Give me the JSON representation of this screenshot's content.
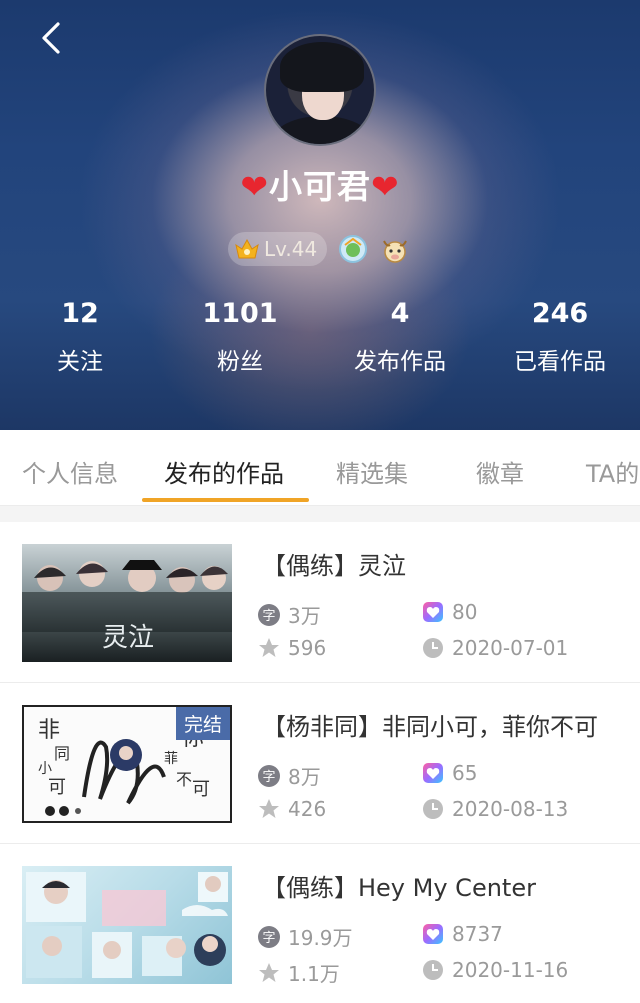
{
  "header": {
    "nickname": "小可君",
    "heart_left": "❤",
    "heart_right": "❤",
    "level": "Lv.44",
    "stats": [
      {
        "num": "12",
        "label": "关注"
      },
      {
        "num": "1101",
        "label": "粉丝"
      },
      {
        "num": "4",
        "label": "发布作品"
      },
      {
        "num": "246",
        "label": "已看作品"
      }
    ]
  },
  "tabs": [
    "个人信息",
    "发布的作品",
    "精选集",
    "徽章",
    "TA的"
  ],
  "works": [
    {
      "title": "【偶练】灵泣",
      "words": "3万",
      "likes": "80",
      "stars": "596",
      "date": "2020-07-01",
      "cover_text": "灵泣",
      "status": ""
    },
    {
      "title": "【杨非同】非同小可，菲你不可",
      "words": "8万",
      "likes": "65",
      "stars": "426",
      "date": "2020-08-13",
      "cover_text": "非同小可 菲你不可",
      "status": "完结"
    },
    {
      "title": "【偶练】Hey My Center",
      "words": "19.9万",
      "likes": "8737",
      "stars": "1.1万",
      "date": "2020-11-16",
      "cover_text": "",
      "status": ""
    }
  ],
  "colors": {
    "accent": "#f0a426",
    "done_badge": "#4a6ba8",
    "heart": "#e8262f"
  }
}
